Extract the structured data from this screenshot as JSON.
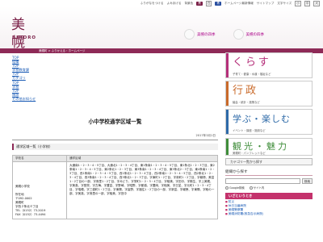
{
  "header": {
    "logo_kanji": "美幌",
    "logo_roman": "BIHORO",
    "topnav": [
      "ふりがなをつける",
      "よみあげる",
      "背景色",
      "黒",
      "白",
      "青",
      "ホームページ最新情報",
      "サイトマップ"
    ],
    "font_size_label": "文字サイズ",
    "font_sizes": [
      "小",
      "中",
      "大"
    ],
    "mascots": [
      "美幌の四季",
      "美幌の四季"
    ],
    "crumb": "美幌町 > ふりかえる・ホームページ"
  },
  "leftnav": [
    "TOP",
    "組織",
    "TOP",
    "学校教育課",
    "TOP",
    "カテゴリ",
    "TOP",
    "学校",
    "TOP",
    "施設",
    "その他お知らせ"
  ],
  "main": {
    "title": "小中学校通学区域一覧",
    "date": "2017年3月1日",
    "section": "通学区域一覧（小学校）",
    "table_headers": [
      "学校名",
      "通学区域"
    ],
    "school_lines": [
      "美幌小学校",
      "",
      "所在地",
      "〒092-0002",
      "美幌町",
      "字西２条北４丁目",
      "TEL（0152）73-2019",
      "FAX（0152）73-4494"
    ],
    "area_text": "大通南1・2・3・4・5丁目、大通北1・2・3・4丁目、東1条南1・2・3・4・5丁目、東1条北1・2・3丁目、東2条南1・2・3・4・5丁目、東2条北1・2・3丁目、東3条南1・2・3・4丁目、東3条北2・3丁目、東4条南1・2・3丁目、西1条南1・2・3・4・5丁目、西1条北1・2・3・4丁目、西2条南1・2・3・4・5丁目、西2条北1・2・3・4丁目、西3条南1・2・3・4丁目、西3条北1・2・3丁目、字東町1・2丁目、字新町1・2丁目、字報徳、美富1・2丁目の一部、字鳥里1・2丁目、字みどり、字栄町1・2・3・4丁目、字稲美、字田中、字駒生、字上美幌、字美禽、字登栄、字古梅、字豊富、字野崎、字昭野、字都橋、字豊岡、字稲美、字日並、字元町1・2・3・4丁目、字瑞穂、字三橋町1・2丁目、字東陽、字高野、字福住1・2丁目の一部、字新富、字報徳、字東陽、字睦の一部、字美禽、字鳥里の一部、字稲美、字田中"
  },
  "right": {
    "tiles": [
      {
        "jp": "くらす",
        "sub": "子育て・健康・水道・福祉など"
      },
      {
        "jp": "行政",
        "sub": "議会・統計・施策など"
      },
      {
        "jp": "学ぶ・楽しむ",
        "sub": "イベント・講座・施設など"
      },
      {
        "jp": "観光・魅力",
        "sub": "美幌町・パンフレットなど"
      }
    ],
    "category_button": "カテゴリ一覧から探す",
    "search_label": "組織から探す",
    "search_button": "検索",
    "search_options": [
      "Google検索",
      "サイト内"
    ],
    "emergency_title": "いざというとき",
    "emergency_links": [
      "防災",
      "休日当番病院",
      "美幌警察署",
      "美幌消防署(救急告示病院)"
    ]
  }
}
